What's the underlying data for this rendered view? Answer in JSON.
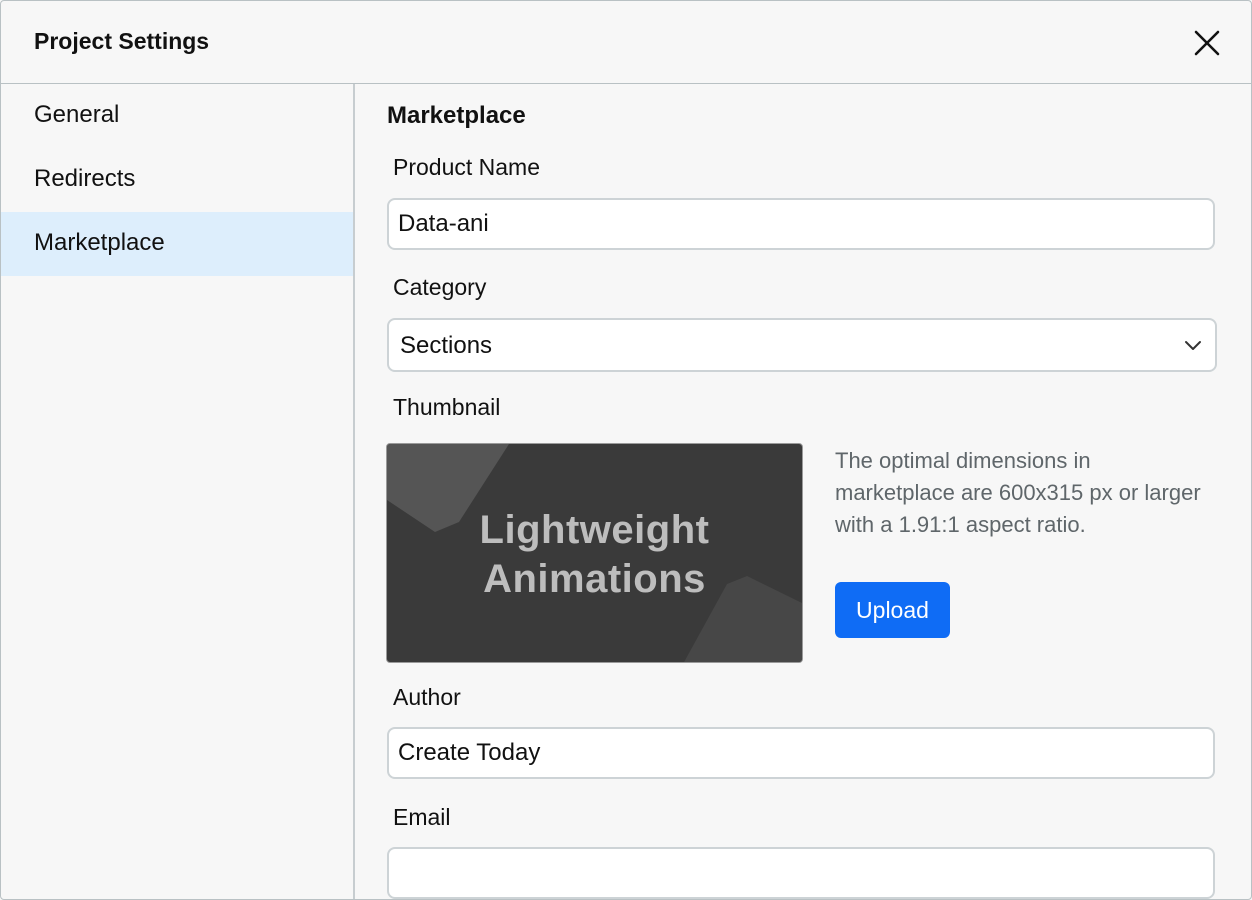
{
  "dialog": {
    "title": "Project Settings",
    "close_icon": "close-icon"
  },
  "sidebar": {
    "items": [
      {
        "label": "General",
        "active": false
      },
      {
        "label": "Redirects",
        "active": false
      },
      {
        "label": "Marketplace",
        "active": true
      }
    ]
  },
  "main": {
    "section_title": "Marketplace",
    "product_name": {
      "label": "Product Name",
      "value": "Data-ani"
    },
    "category": {
      "label": "Category",
      "value": "Sections",
      "icon": "chevron-down-icon"
    },
    "thumbnail": {
      "label": "Thumbnail",
      "image_line1": "Lightweight",
      "image_line2": "Animations",
      "hint": "The optimal dimensions in marketplace are 600x315 px or larger with a 1.91:1 aspect ratio.",
      "upload_label": "Upload"
    },
    "author": {
      "label": "Author",
      "value": "Create Today"
    },
    "email": {
      "label": "Email",
      "value": ""
    }
  },
  "colors": {
    "accent": "#0f6cf5",
    "active_nav": "#ddeefc",
    "background": "#f7f7f7",
    "border": "#b9c1c4"
  }
}
